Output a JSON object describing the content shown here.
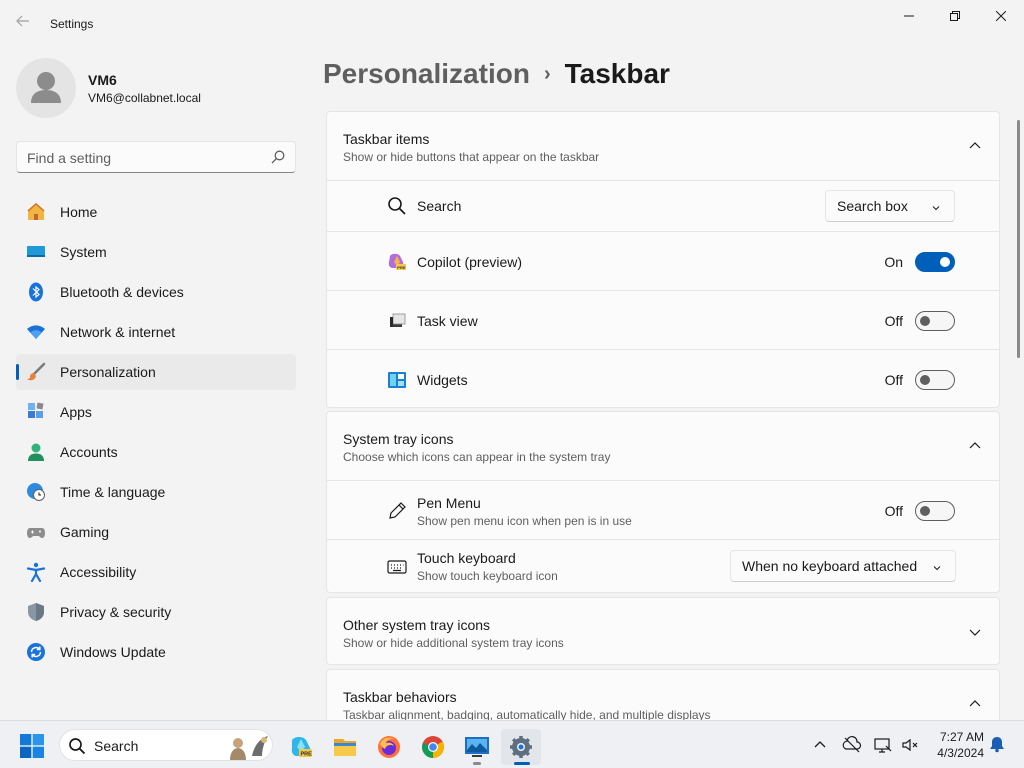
{
  "window": {
    "title": "Settings",
    "back_icon": "back-arrow-icon",
    "controls": [
      "minimize-icon",
      "restore-icon",
      "close-icon"
    ]
  },
  "profile": {
    "name": "VM6",
    "email": "VM6@collabnet.local",
    "avatar_icon": "user-avatar-icon"
  },
  "search": {
    "placeholder": "Find a setting",
    "value": "",
    "icon": "search-icon"
  },
  "sidebar": {
    "active_index": 4,
    "items": [
      {
        "label": "Home",
        "icon": "home-icon"
      },
      {
        "label": "System",
        "icon": "monitor-icon"
      },
      {
        "label": "Bluetooth & devices",
        "icon": "bluetooth-icon"
      },
      {
        "label": "Network & internet",
        "icon": "wifi-icon"
      },
      {
        "label": "Personalization",
        "icon": "brush-icon"
      },
      {
        "label": "Apps",
        "icon": "apps-icon"
      },
      {
        "label": "Accounts",
        "icon": "person-icon"
      },
      {
        "label": "Time & language",
        "icon": "globe-clock-icon"
      },
      {
        "label": "Gaming",
        "icon": "controller-icon"
      },
      {
        "label": "Accessibility",
        "icon": "accessibility-icon"
      },
      {
        "label": "Privacy & security",
        "icon": "shield-icon"
      },
      {
        "label": "Windows Update",
        "icon": "update-icon"
      }
    ]
  },
  "breadcrumb": {
    "parent": "Personalization",
    "separator": "›",
    "current": "Taskbar"
  },
  "sections": {
    "taskbar_items": {
      "title": "Taskbar items",
      "subtitle": "Show or hide buttons that appear on the taskbar",
      "expanded": true,
      "search": {
        "label": "Search",
        "icon": "search-icon",
        "value": "Search box"
      },
      "copilot": {
        "label": "Copilot (preview)",
        "icon": "copilot-icon",
        "state": "On",
        "on": true
      },
      "task_view": {
        "label": "Task view",
        "icon": "task-view-icon",
        "state": "Off",
        "on": false
      },
      "widgets": {
        "label": "Widgets",
        "icon": "widgets-icon",
        "state": "Off",
        "on": false
      }
    },
    "system_tray": {
      "title": "System tray icons",
      "subtitle": "Choose which icons can appear in the system tray",
      "expanded": true,
      "pen_menu": {
        "label": "Pen Menu",
        "sublabel": "Show pen menu icon when pen is in use",
        "icon": "pen-icon",
        "state": "Off",
        "on": false
      },
      "touch_keyboard": {
        "label": "Touch keyboard",
        "sublabel": "Show touch keyboard icon",
        "icon": "keyboard-icon",
        "value": "When no keyboard attached"
      }
    },
    "other_tray": {
      "title": "Other system tray icons",
      "subtitle": "Show or hide additional system tray icons",
      "expanded": false
    },
    "behaviors": {
      "title": "Taskbar behaviors",
      "subtitle": "Taskbar alignment, badging, automatically hide, and multiple displays",
      "expanded": true
    }
  },
  "taskbar": {
    "search_label": "Search",
    "apps": [
      {
        "name": "copilot-app-icon"
      },
      {
        "name": "file-explorer-icon"
      },
      {
        "name": "firefox-icon"
      },
      {
        "name": "chrome-icon"
      },
      {
        "name": "remote-desktop-icon"
      },
      {
        "name": "settings-icon",
        "active": true
      }
    ],
    "tray": [
      "chevron-up-icon",
      "network-icon",
      "display-icon",
      "volume-muted-icon",
      "notification-bell-icon"
    ],
    "time": "7:27 AM",
    "date": "4/3/2024"
  },
  "colors": {
    "accent": "#005fb8",
    "background": "#f3f3f3",
    "card": "#fbfbfb"
  }
}
